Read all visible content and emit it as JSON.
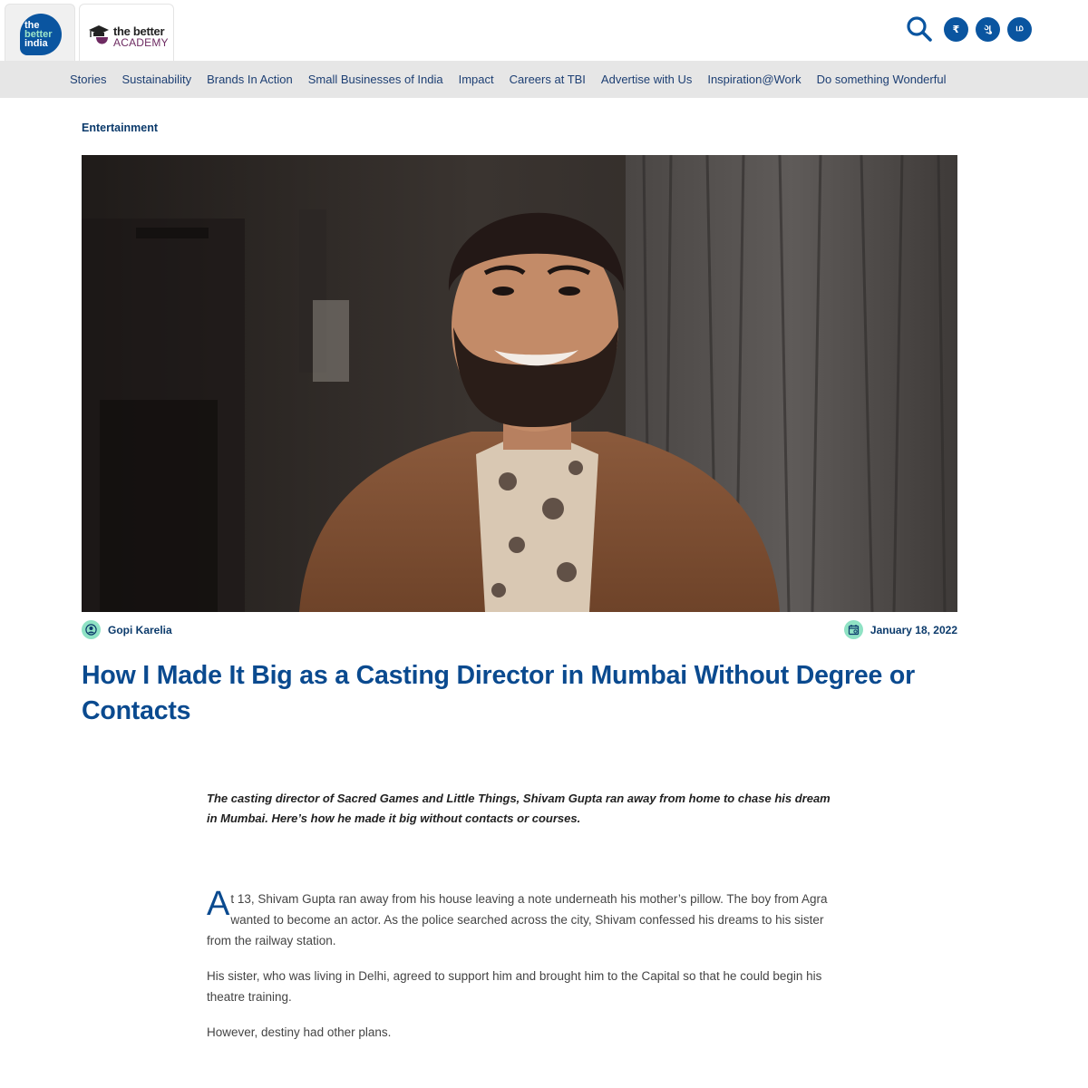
{
  "header": {
    "tbi_logo": [
      "the",
      "better",
      "india"
    ],
    "academy_logo": {
      "top": "the better",
      "bottom": "ACADEMY"
    },
    "languages": [
      "₹",
      "ગુ",
      "ம"
    ],
    "icons": {
      "search": "search-icon",
      "brand_color": "#0a55a0"
    }
  },
  "nav": {
    "items": [
      "Stories",
      "Sustainability",
      "Brands In Action",
      "Small Businesses of India",
      "Impact",
      "Careers at TBI",
      "Advertise with Us",
      "Inspiration@Work",
      "Do something Wonderful"
    ]
  },
  "article": {
    "category": "Entertainment",
    "author": "Gopi Karelia",
    "date": "January 18, 2022",
    "title": "How I Made It Big as a Casting Director in Mumbai Without Degree or Contacts",
    "lede": "The casting director of Sacred Games and Little Things, Shivam Gupta ran away from home to chase his dream in Mumbai. Here’s how he made it big without contacts or courses.",
    "dropcap": "A",
    "first_paragraph": "t 13, Shivam Gupta ran away from his house leaving a note underneath his mother’s pillow. The boy from Agra wanted to become an actor. As the police searched across the city, Shivam confessed his dreams to his sister from the railway station.",
    "paragraphs": [
      "His sister, who was living in Delhi, agreed to support him and brought him to the Capital so that he could begin his theatre training.",
      "However, destiny had other plans."
    ],
    "accent_color": "#0a4a8f",
    "meta_icon_color": "#8fe2c4"
  }
}
